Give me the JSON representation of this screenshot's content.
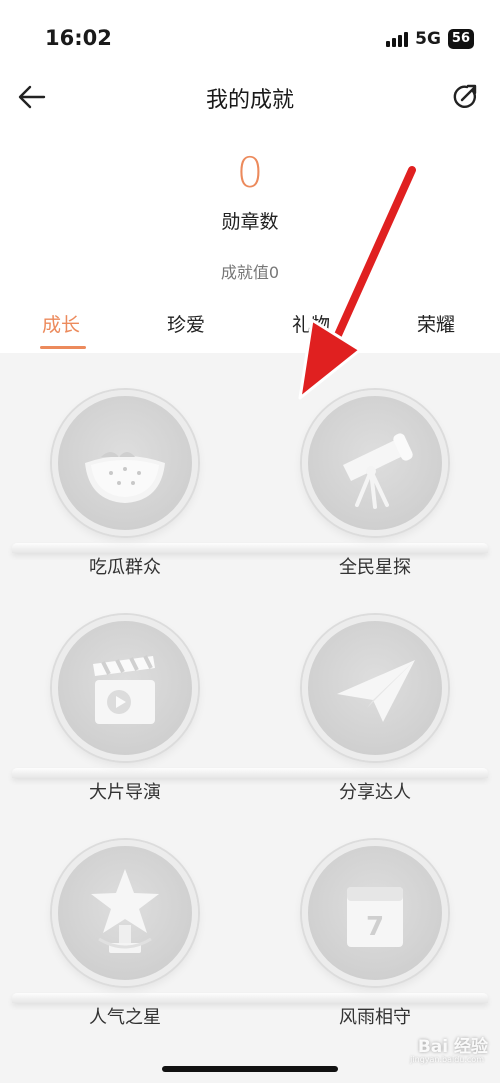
{
  "status": {
    "time": "16:02",
    "network": "5G",
    "battery": "56"
  },
  "header": {
    "title": "我的成就"
  },
  "summary": {
    "badge_count": "0",
    "badge_label": "勋章数",
    "score": "成就值0"
  },
  "tabs": [
    {
      "label": "成长",
      "active": true
    },
    {
      "label": "珍爱",
      "active": false
    },
    {
      "label": "礼物",
      "active": false
    },
    {
      "label": "荣耀",
      "active": false
    }
  ],
  "badges": [
    {
      "name": "吃瓜群众",
      "icon": "watermelon-icon"
    },
    {
      "name": "全民星探",
      "icon": "telescope-icon"
    },
    {
      "name": "大片导演",
      "icon": "clapperboard-icon"
    },
    {
      "name": "分享达人",
      "icon": "paper-plane-icon"
    },
    {
      "name": "人气之星",
      "icon": "star-trophy-icon"
    },
    {
      "name": "风雨相守",
      "icon": "calendar-icon"
    }
  ],
  "calendar_day": "7",
  "colors": {
    "accent": "#ec8a5c",
    "annotation_arrow": "#e02020"
  },
  "watermark": {
    "text": "Bai 经验",
    "sub": "jingyan.baidu.com"
  }
}
